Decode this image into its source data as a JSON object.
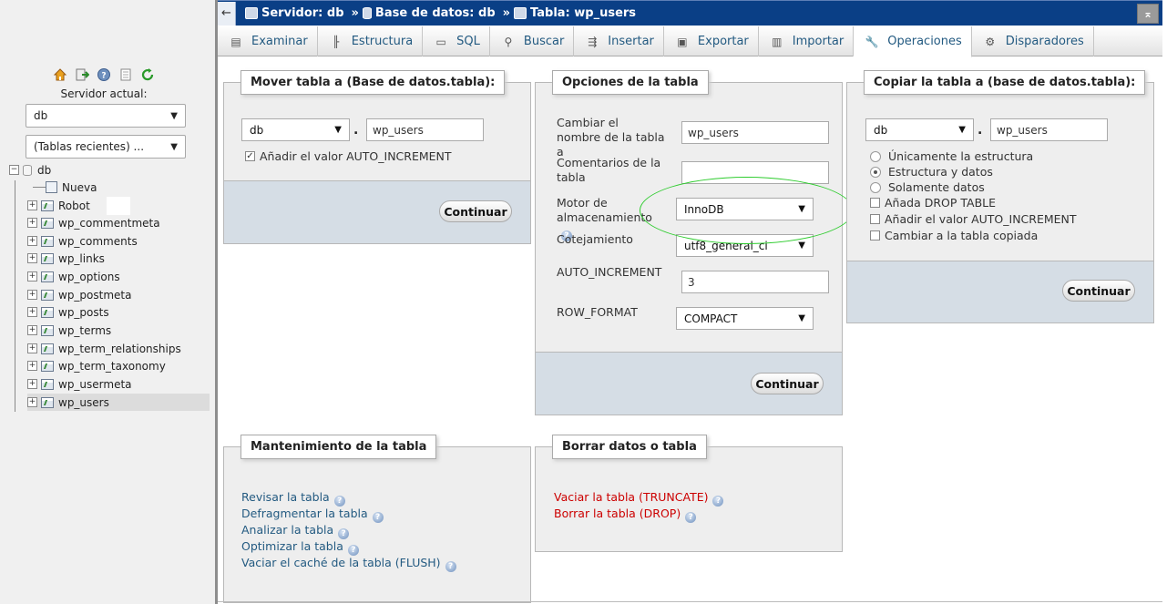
{
  "nav": {
    "icons": [
      "home-icon",
      "logout-icon",
      "help-icon",
      "docs-icon",
      "reload-icon"
    ],
    "server_label": "Servidor actual:",
    "server_select": "db",
    "recent_select": "(Tablas recientes) ...",
    "db_name": "db",
    "new_label": "Nueva",
    "tables": [
      "Robot",
      "wp_commentmeta",
      "wp_comments",
      "wp_links",
      "wp_options",
      "wp_postmeta",
      "wp_posts",
      "wp_terms",
      "wp_term_relationships",
      "wp_term_taxonomy",
      "wp_usermeta",
      "wp_users"
    ],
    "selected_table": "wp_users"
  },
  "breadcrumb": {
    "server": "Servidor: db",
    "database": "Base de datos: db",
    "table": "Tabla: wp_users",
    "sep": "»"
  },
  "tabs": [
    {
      "label": "Examinar",
      "icon": "browse-icon"
    },
    {
      "label": "Estructura",
      "icon": "structure-icon"
    },
    {
      "label": "SQL",
      "icon": "sql-icon"
    },
    {
      "label": "Buscar",
      "icon": "search-icon"
    },
    {
      "label": "Insertar",
      "icon": "insert-icon"
    },
    {
      "label": "Exportar",
      "icon": "export-icon"
    },
    {
      "label": "Importar",
      "icon": "import-icon"
    },
    {
      "label": "Operaciones",
      "icon": "wrench-icon",
      "active": true
    },
    {
      "label": "Disparadores",
      "icon": "triggers-icon"
    }
  ],
  "move": {
    "legend": "Mover tabla a (Base de datos.tabla):",
    "db": "db",
    "dot": ".",
    "table": "wp_users",
    "auto_inc_label": "Añadir el valor AUTO_INCREMENT",
    "auto_inc_checked": true,
    "button": "Continuar"
  },
  "options": {
    "legend": "Opciones de la tabla",
    "rename_label": "Cambiar el nombre de la tabla a",
    "rename_value": "wp_users",
    "comments_label": "Comentarios de la tabla",
    "comments_value": "",
    "engine_label": "Motor de almacenamiento",
    "engine_value": "InnoDB",
    "collation_label": "Cotejamiento",
    "collation_value": "utf8_general_ci",
    "autoinc_label": "AUTO_INCREMENT",
    "autoinc_value": "3",
    "rowformat_label": "ROW_FORMAT",
    "rowformat_value": "COMPACT",
    "button": "Continuar"
  },
  "copy": {
    "legend": "Copiar la tabla a (base de datos.tabla):",
    "db": "db",
    "dot": ".",
    "table": "wp_users",
    "radio_structure": "Únicamente la estructura",
    "radio_structure_data": "Estructura y datos",
    "radio_data": "Solamente datos",
    "selected_radio": "Estructura y datos",
    "check_drop": "Añada DROP TABLE",
    "check_autoinc": "Añadir el valor AUTO_INCREMENT",
    "check_switch": "Cambiar a la tabla copiada",
    "button": "Continuar"
  },
  "maintenance": {
    "legend": "Mantenimiento de la tabla",
    "links": [
      "Revisar la tabla",
      "Defragmentar la tabla",
      "Analizar la tabla",
      "Optimizar la tabla",
      "Vaciar el caché de la tabla (FLUSH)"
    ]
  },
  "delete": {
    "legend": "Borrar datos o tabla",
    "links": [
      "Vaciar la tabla (TRUNCATE)",
      "Borrar la tabla (DROP)"
    ]
  },
  "colors": {
    "topbar": "#0a3f86",
    "link": "#235a81",
    "danger": "#c00000",
    "highlight_ellipse": "#2ecc2e"
  }
}
